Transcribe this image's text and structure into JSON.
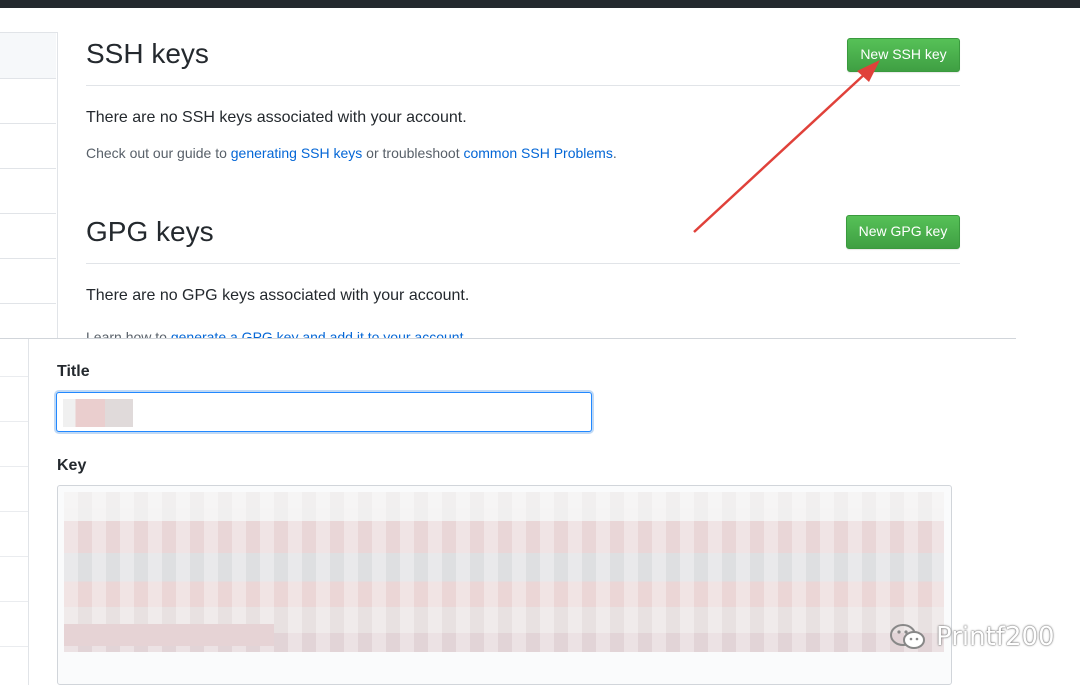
{
  "ssh": {
    "title": "SSH keys",
    "button": "New SSH key",
    "empty": "There are no SSH keys associated with your account.",
    "help_prefix": "Check out our guide to ",
    "help_link1": "generating SSH keys",
    "help_mid": " or troubleshoot ",
    "help_link2": "common SSH Problems",
    "help_end": "."
  },
  "gpg": {
    "title": "GPG keys",
    "button": "New GPG key",
    "empty": "There are no GPG keys associated with your account.",
    "help_prefix": "Learn how to ",
    "help_link": "generate a GPG key and add it to your account",
    "help_end": "."
  },
  "form": {
    "title_label": "Title",
    "key_label": "Key"
  },
  "watermark": {
    "text": "Printf200",
    "icon": "wechat-icon"
  },
  "annotation": {
    "icon": "red-arrow-icon",
    "color": "#e0413a"
  },
  "colors": {
    "primary_button": "#3f9f43",
    "link": "#0366d6",
    "focus": "#2188ff"
  }
}
